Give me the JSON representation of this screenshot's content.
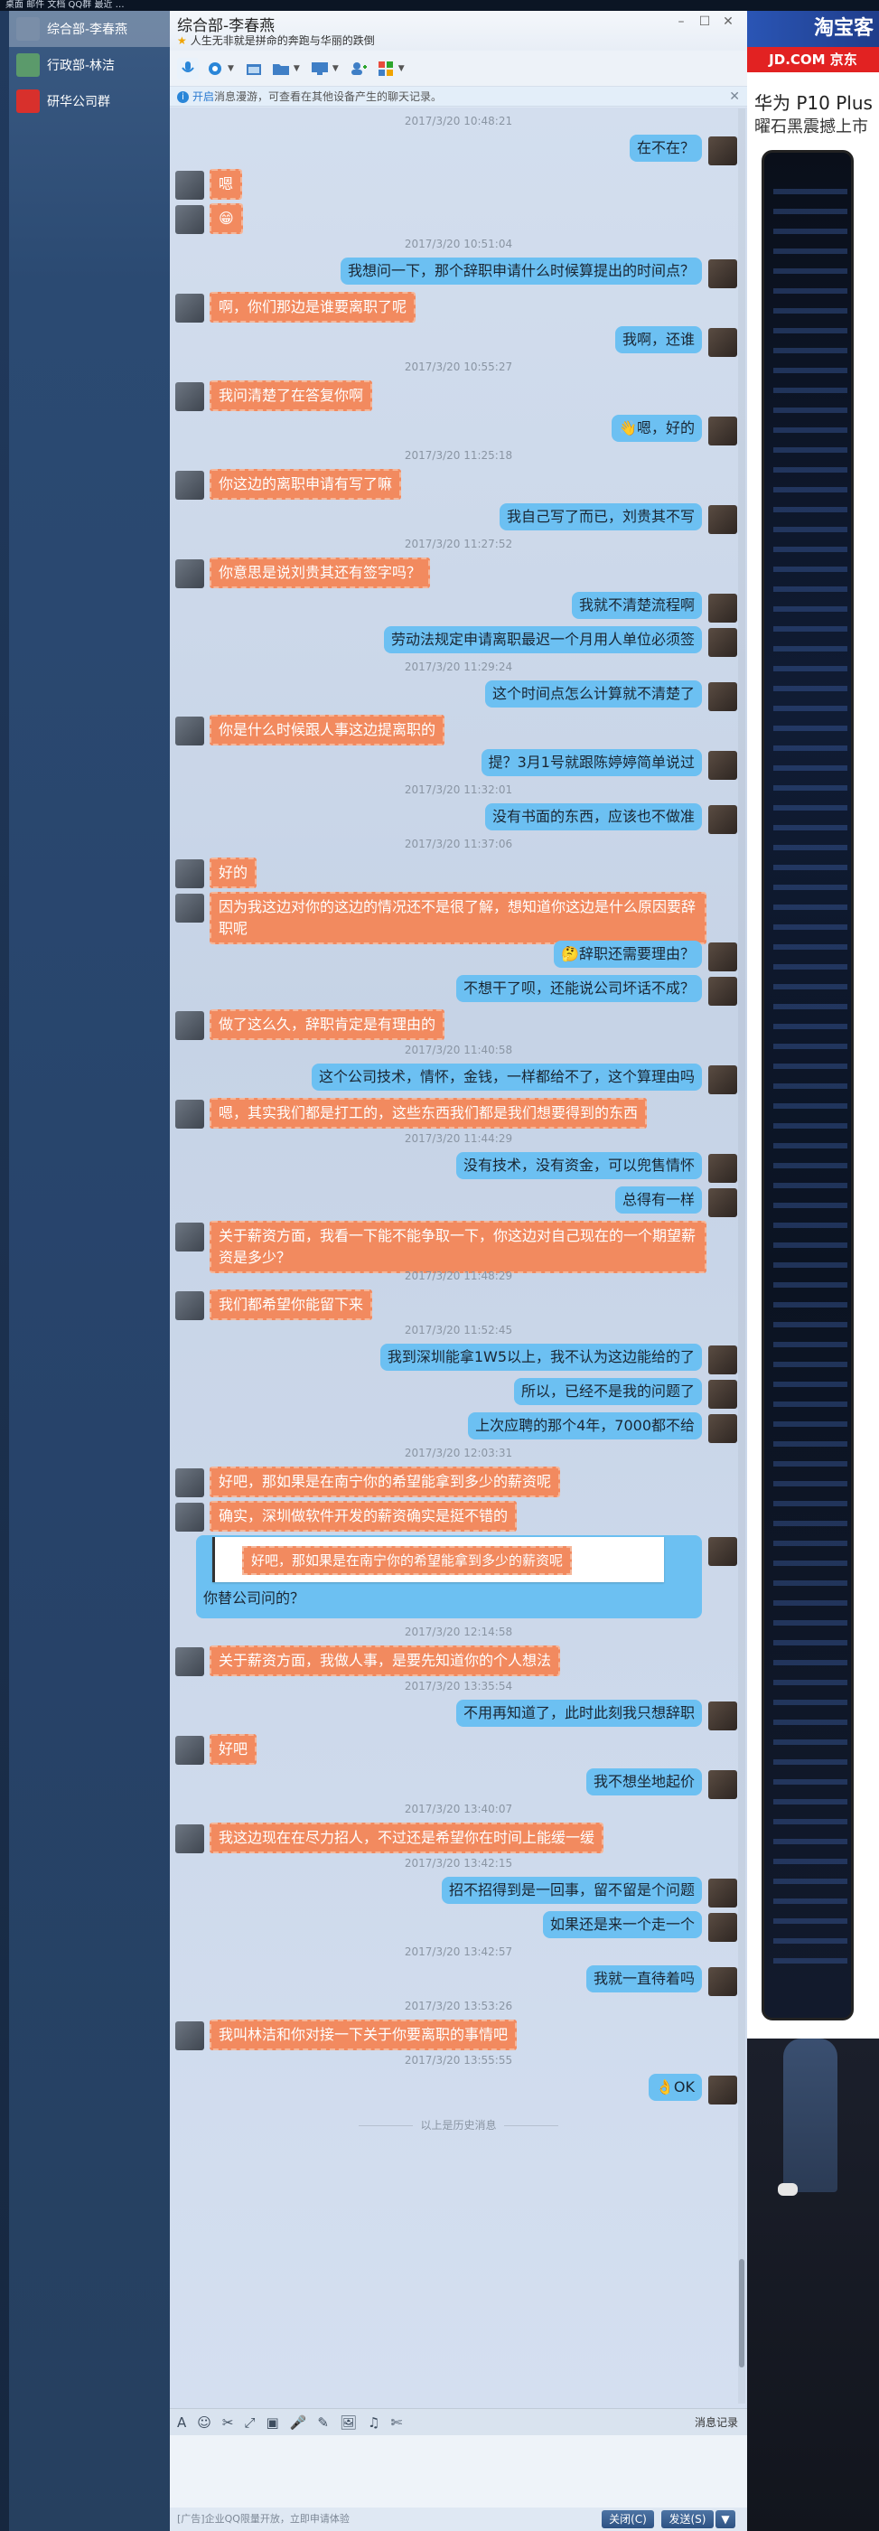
{
  "desktop": {
    "topbar_text": "桌面  邮件  文档  QQ群  最近  …"
  },
  "sidebar": {
    "contacts": [
      {
        "label": "综合部-李春燕",
        "active": true,
        "color": "#7a8ea8"
      },
      {
        "label": "行政部-林洁",
        "active": false,
        "color": "#5b9a6b"
      },
      {
        "label": "研华公司群",
        "active": false,
        "color": "#d8302c"
      }
    ]
  },
  "window": {
    "title": "综合部-李春燕",
    "signature": "人生无非就是拼命的奔跑与华丽的跌倒",
    "controls": {
      "minimize": "–",
      "restore": "☐",
      "close": "✕"
    }
  },
  "notice": {
    "link": "开启",
    "text": "消息漫游，可查看在其他设备产生的聊天记录。",
    "close": "✕"
  },
  "colors": {
    "bubble_left": "#f28a5f",
    "bubble_right": "#6cc0f2",
    "accent": "#2e5283"
  },
  "messages": [
    {
      "type": "ts",
      "text": "2017/3/20 10:48:21"
    },
    {
      "type": "out",
      "text": "在不在？"
    },
    {
      "type": "in",
      "text": "嗯"
    },
    {
      "type": "in",
      "text": "😁"
    },
    {
      "type": "ts",
      "text": "2017/3/20 10:51:04"
    },
    {
      "type": "out",
      "text": "我想问一下，那个辞职申请什么时候算提出的时间点？"
    },
    {
      "type": "in",
      "text": "啊，你们那边是谁要离职了呢"
    },
    {
      "type": "out",
      "text": "我啊，还谁"
    },
    {
      "type": "ts",
      "text": "2017/3/20 10:55:27"
    },
    {
      "type": "in",
      "text": "我问清楚了在答复你啊"
    },
    {
      "type": "out",
      "text": "👋嗯，好的"
    },
    {
      "type": "ts",
      "text": "2017/3/20 11:25:18"
    },
    {
      "type": "in",
      "text": "你这边的离职申请有写了嘛"
    },
    {
      "type": "out",
      "text": "我自己写了而已，刘贵其不写"
    },
    {
      "type": "ts",
      "text": "2017/3/20 11:27:52"
    },
    {
      "type": "in",
      "text": "你意思是说刘贵其还有签字吗？"
    },
    {
      "type": "out",
      "text": "我就不清楚流程啊"
    },
    {
      "type": "out",
      "text": "劳动法规定申请离职最迟一个月用人单位必须签"
    },
    {
      "type": "ts",
      "text": "2017/3/20 11:29:24"
    },
    {
      "type": "out",
      "text": "这个时间点怎么计算就不清楚了"
    },
    {
      "type": "in",
      "text": "你是什么时候跟人事这边提离职的"
    },
    {
      "type": "out",
      "text": "提？3月1号就跟陈婷婷简单说过"
    },
    {
      "type": "ts",
      "text": "2017/3/20 11:32:01"
    },
    {
      "type": "out",
      "text": "没有书面的东西，应该也不做准"
    },
    {
      "type": "ts",
      "text": "2017/3/20 11:37:06"
    },
    {
      "type": "in",
      "text": "好的"
    },
    {
      "type": "in2",
      "text": "因为我这边对你的这边的情况还不是很了解，想知道你这边是什么原因要辞职呢"
    },
    {
      "type": "out",
      "text": "🤔辞职还需要理由？"
    },
    {
      "type": "out",
      "text": "不想干了呗，还能说公司坏话不成？"
    },
    {
      "type": "in",
      "text": "做了这么久，辞职肯定是有理由的"
    },
    {
      "type": "ts",
      "text": "2017/3/20 11:40:58"
    },
    {
      "type": "out",
      "text": "这个公司技术，情怀，金钱，一样都给不了，这个算理由吗"
    },
    {
      "type": "in",
      "text": "嗯，其实我们都是打工的，这些东西我们都是我们想要得到的东西"
    },
    {
      "type": "ts",
      "text": "2017/3/20 11:44:29"
    },
    {
      "type": "out",
      "text": "没有技术，没有资金，可以兜售情怀"
    },
    {
      "type": "out",
      "text": "总得有一样"
    },
    {
      "type": "in2",
      "text": "关于薪资方面，我看一下能不能争取一下，你这边对自己现在的一个期望薪资是多少？"
    },
    {
      "type": "ts",
      "text": "2017/3/20 11:48:29"
    },
    {
      "type": "in",
      "text": "我们都希望你能留下来"
    },
    {
      "type": "ts",
      "text": "2017/3/20 11:52:45"
    },
    {
      "type": "out",
      "text": "我到深圳能拿1W5以上，我不认为这边能给的了"
    },
    {
      "type": "out",
      "text": "所以，已经不是我的问题了"
    },
    {
      "type": "out",
      "text": "上次应聘的那个4年，7000都不给"
    },
    {
      "type": "ts",
      "text": "2017/3/20 12:03:31"
    },
    {
      "type": "in",
      "text": "好吧，那如果是在南宁你的希望能拿到多少的薪资呢"
    },
    {
      "type": "in",
      "text": "确实，深圳做软件开发的薪资确实是挺不错的"
    },
    {
      "type": "quote",
      "quote": "好吧，那如果是在南宁你的希望能拿到多少的薪资呢",
      "text": "你替公司问的？"
    },
    {
      "type": "ts",
      "text": "2017/3/20 12:14:58"
    },
    {
      "type": "in",
      "text": "关于薪资方面，我做人事，是要先知道你的个人想法"
    },
    {
      "type": "ts",
      "text": "2017/3/20 13:35:54"
    },
    {
      "type": "out",
      "text": "不用再知道了，此时此刻我只想辞职"
    },
    {
      "type": "in",
      "text": "好吧"
    },
    {
      "type": "out",
      "text": "我不想坐地起价"
    },
    {
      "type": "ts",
      "text": "2017/3/20 13:40:07"
    },
    {
      "type": "in",
      "text": "我这边现在在尽力招人，不过还是希望你在时间上能缓一缓"
    },
    {
      "type": "ts",
      "text": "2017/3/20 13:42:15"
    },
    {
      "type": "out",
      "text": "招不招得到是一回事，留不留是个问题"
    },
    {
      "type": "out",
      "text": "如果还是来一个走一个"
    },
    {
      "type": "ts",
      "text": "2017/3/20 13:42:57"
    },
    {
      "type": "out",
      "text": "我就一直待着吗"
    },
    {
      "type": "ts",
      "text": "2017/3/20 13:53:26"
    },
    {
      "type": "in",
      "text": "我叫林洁和你对接一下关于你要离职的事情吧"
    },
    {
      "type": "ts",
      "text": "2017/3/20 13:55:55"
    },
    {
      "type": "out",
      "text": "👌OK"
    }
  ],
  "history_label": "以上是历史消息",
  "input_toolbar": {
    "icons": [
      "A",
      "☺",
      "✂",
      "⤢",
      "▣",
      "🎤",
      "✎",
      "🖼",
      "♫",
      "✄"
    ],
    "history_button": "消息记录"
  },
  "footer": {
    "ad": "[广告]企业QQ限量开放，立即申请体验",
    "close": "关闭(C)",
    "send": "发送(S)",
    "send_arrow": "▼"
  },
  "ads": {
    "taobao": "淘宝客",
    "jd": "JD.COM 京东",
    "huawei_title": "华为 P10 Plus",
    "huawei_sub": "曜石黑震撼上市"
  }
}
